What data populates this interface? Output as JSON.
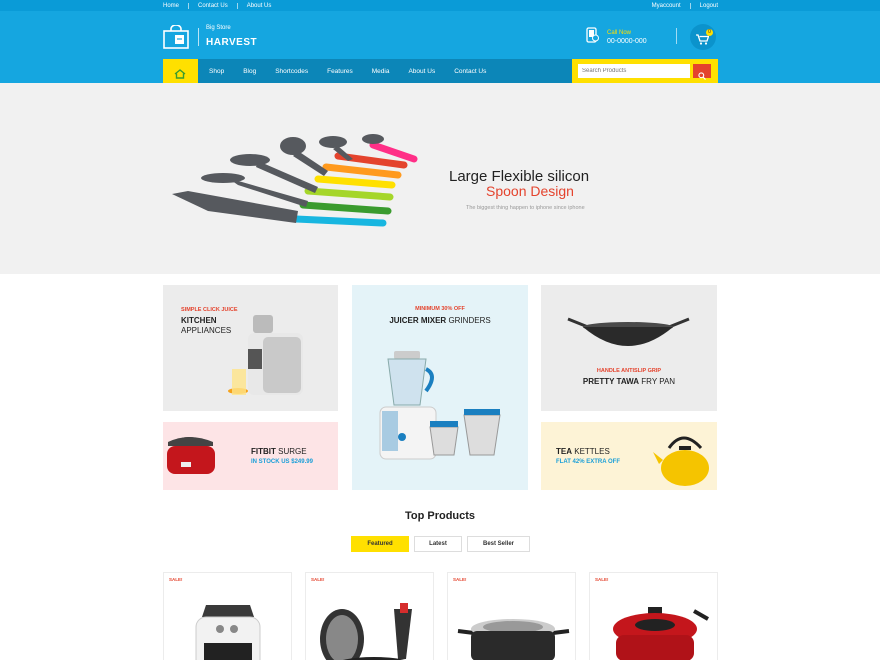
{
  "topbar": {
    "links": [
      "Home",
      "Contact Us",
      "About Us"
    ],
    "account": [
      "Myaccount",
      "Logout"
    ]
  },
  "header": {
    "logo_small": "Big Store",
    "logo_big": "HARVEST",
    "call_label": "Call Now",
    "call_number": "00-0000-000",
    "cart_count": "0"
  },
  "nav": {
    "items": [
      "Shop",
      "Blog",
      "Shortcodes",
      "Features",
      "Media",
      "About Us",
      "Contact Us"
    ],
    "search_placeholder": "Search Products"
  },
  "hero": {
    "title": "Large Flexible silicon",
    "subtitle": "Spoon Design",
    "caption": "The biggest thing happen to iphone since iphone"
  },
  "banners": {
    "kitchen": {
      "tag": "SIMPLE CLICK JUICE",
      "line1": "KITCHEN",
      "line2": "APPLIANCES"
    },
    "fitbit": {
      "bold": "FITBIT",
      "rest": "SURGE",
      "stock": "IN STOCK US $249.99"
    },
    "juicer": {
      "tag": "MINIMUM 30% OFF",
      "bold": "JUICER MIXER",
      "rest": "GRINDERS"
    },
    "tawa": {
      "tag": "HANDLE ANTISLIP GRIP",
      "bold": "PRETTY TAWA",
      "rest": "FRY PAN"
    },
    "kettle": {
      "bold": "TEA",
      "rest": "KETTLES",
      "offer": "FLAT 42% EXTRA OFF"
    }
  },
  "top_products": {
    "title": "Top Products",
    "tabs": [
      "Featured",
      "Latest",
      "Best Seller"
    ],
    "sale_label": "SALE!"
  },
  "colors": {
    "header_blue": "#15a6e0",
    "nav_dark": "#0c86b8",
    "accent_yellow": "#ffe000",
    "accent_red": "#e4432d"
  },
  "icons": [
    "shopping-bag-logo-icon",
    "phone-icon",
    "cart-icon",
    "home-icon",
    "search-icon"
  ]
}
